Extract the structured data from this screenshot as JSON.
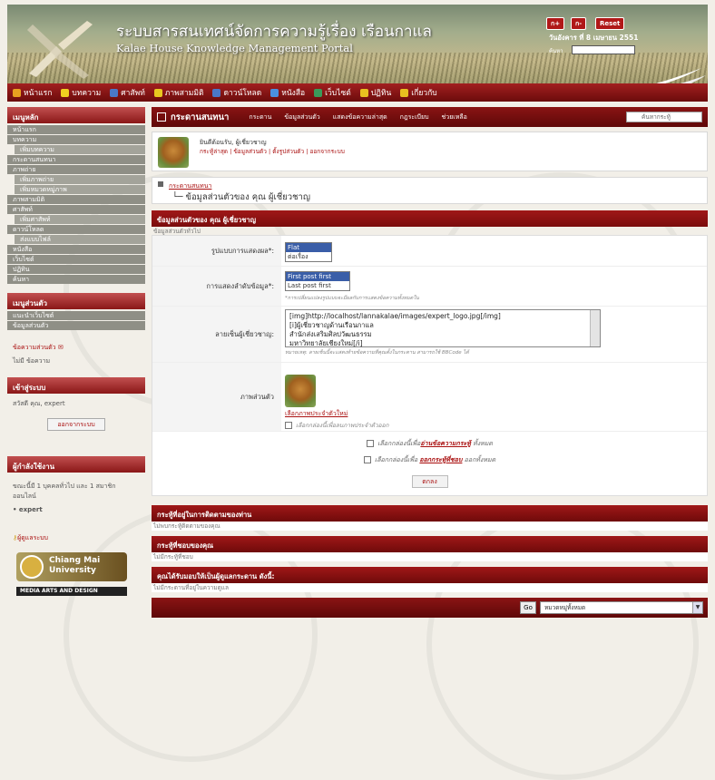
{
  "banner": {
    "title_th": "ระบบสารสนเทศน์จัดการความรู้เรื่อง เรือนกาแล",
    "title_en": "Kalae House Knowledge Management Portal",
    "font_buttons": [
      "ก+",
      "ก-",
      "Reset"
    ],
    "date": "วันอังคาร ที่ 8 เมษายน 2551",
    "search_label": "ค้นหา"
  },
  "nav": [
    {
      "label": "หน้าแรก",
      "icon": "home-icon",
      "color": "#e8a020"
    },
    {
      "label": "บทความ",
      "icon": "bulb-icon",
      "color": "#f0d020"
    },
    {
      "label": "ศาสัพท์",
      "icon": "book-icon",
      "color": "#4a78c8"
    },
    {
      "label": "ภาพสามมิติ",
      "icon": "pencil-icon",
      "color": "#e8c820"
    },
    {
      "label": "ดาวน์โหลด",
      "icon": "download-icon",
      "color": "#4a78c8"
    },
    {
      "label": "หนังสือ",
      "icon": "books-icon",
      "color": "#4a90e0"
    },
    {
      "label": "เว็บไซต์",
      "icon": "globe-icon",
      "color": "#3a9a5a"
    },
    {
      "label": "ปฏิทิน",
      "icon": "calendar-icon",
      "color": "#e8c020"
    },
    {
      "label": "เกี่ยวกับ",
      "icon": "info-icon",
      "color": "#e8c020"
    }
  ],
  "sidebar": {
    "menu_title": "เมนูหลัก",
    "menu_items": [
      {
        "label": "หน้าแรก",
        "sub": false
      },
      {
        "label": "บทความ",
        "sub": false
      },
      {
        "label": "เพิ่มบทความ",
        "sub": true
      },
      {
        "label": "กระดานสนทนา",
        "sub": false
      },
      {
        "label": "ภาพถ่าย",
        "sub": false
      },
      {
        "label": "เพิ่มภาพถ่าย",
        "sub": true
      },
      {
        "label": "เพิ่มหมวดหมู่ภาพ",
        "sub": true
      },
      {
        "label": "ภาพสามมิติ",
        "sub": false
      },
      {
        "label": "ศาสัพท์",
        "sub": false
      },
      {
        "label": "เพิ่มศาสัพท์",
        "sub": true
      },
      {
        "label": "ดาวน์โหลด",
        "sub": false
      },
      {
        "label": "ส่งแบบไฟล์",
        "sub": true
      },
      {
        "label": "หนังสือ",
        "sub": false
      },
      {
        "label": "เว็บไซต์",
        "sub": false
      },
      {
        "label": "ปฏิทิน",
        "sub": false
      },
      {
        "label": "ค้นหา",
        "sub": false
      }
    ],
    "personal_title": "เมนูส่วนตัว",
    "personal_items": [
      "แนะนำเว็บไซต์",
      "ข้อมูลส่วนตัว"
    ],
    "messages_title": "ข้อความส่วนตัว",
    "messages_text": "ไม่มี ข้อความ",
    "login_title": "เข้าสู่ระบบ",
    "login_text": "สวัสดี คุณ, expert",
    "logout_label": "ออกจากระบบ",
    "online_title": "ผู้กำลังใช้งาน",
    "online_text": "ขณะนี้มี 1 บุคคลทั่วไป และ 1 สมาชิก ออนไลน์",
    "online_user": "• expert",
    "admin_link": "ผู้ดูแลระบบ",
    "cmu_label": "Chiang Mai University",
    "mad_label": "MEDIA ARTS AND DESIGN"
  },
  "forum": {
    "title": "กระดานสนทนา",
    "links": [
      "กระดาน",
      "ข้อมูลส่วนตัว",
      "แสดงข้อความล่าสุด",
      "กฎระเบียบ",
      "ช่วยเหลือ"
    ],
    "search_placeholder": "ค้นหากระทู้",
    "welcome": "ยินดีต้อนรับ, ผู้เชี่ยวชาญ",
    "user_links": "กระทู้ล่าสุด | ข้อมูลส่วนตัว | ตั้งรูปส่วนตัว | ออกจากระบบ",
    "crumb": "กระดานสนทนา",
    "page_heading": "ข้อมูลส่วนตัวของ คุณ ผู้เชี่ยวชาญ"
  },
  "form": {
    "header": "ข้อมูลส่วนตัวของ คุณ ผู้เชี่ยวชาญ",
    "sub": "ข้อมูลส่วนตัวทั่วไป",
    "display_label": "รูปแบบการแสดงผล*:",
    "display_options": [
      "Flat",
      "ต่อเรื่อง"
    ],
    "order_label": "การแสดงลำดับข้อมูล*:",
    "order_options": [
      "First post first",
      "Last post first"
    ],
    "order_hint": "*การเปลี่ยนแปลงรูปแบบจะมีผลกับการแสดงข้อความทั้งหมดใน",
    "sig_label": "ลายเซ็นผู้เชี่ยวชาญ:",
    "sig_lines": [
      "[img]http://localhost/lannakalae/images/expert_logo.jpg[/img]",
      "[i]ผู้เชี่ยวชาญด้านเรือนกาแล",
      "สำนักส่งเสริมศิลปวัฒนธรรม",
      "มหาวิทยาลัยเชียงใหม่[/i]"
    ],
    "sig_hint": "หมายเหตุ: ลายเซ็นนี้จะแสดงท้ายข้อความที่คุณตั้งในกระดาน สามารถใช้ BBCode ได้",
    "avatar_label": "ภาพส่วนตัว",
    "avatar_link": "เลือกภาพประจำตัวใหม่",
    "avatar_remove": "เลือกกล่องนี้เพื่อลบภาพประจำตัวออก",
    "opt1_prefix": "เลือกกล่องนี้เพื่อ",
    "opt1_link": "อ่านข้อความกระทู้",
    "opt1_suffix": "ทั้งหมด",
    "opt2_prefix": "เลือกกล่องนี้เพื่อ",
    "opt2_link": "ออกกระทู้ที่ชอบ",
    "opt2_suffix": "ออกทั้งหมด",
    "submit": "ตกลง"
  },
  "sections": [
    {
      "title": "กระทู้ที่อยู่ในการติดตามของท่าน",
      "text": "ไม่พบกระทู้ติดตามของคุณ"
    },
    {
      "title": "กระทู้ที่ชอบของคุณ",
      "text": "ไม่มีกระทู้ที่ชอบ"
    },
    {
      "title": "คุณได้รับมอบให้เป็นผู้ดูแลกระดาน ดังนี้:",
      "text": "ไม่มีกระดานที่อยู่ในความดูแล"
    }
  ],
  "footer": {
    "go": "Go",
    "category": "หมวดหมู่ทั้งหมด"
  }
}
